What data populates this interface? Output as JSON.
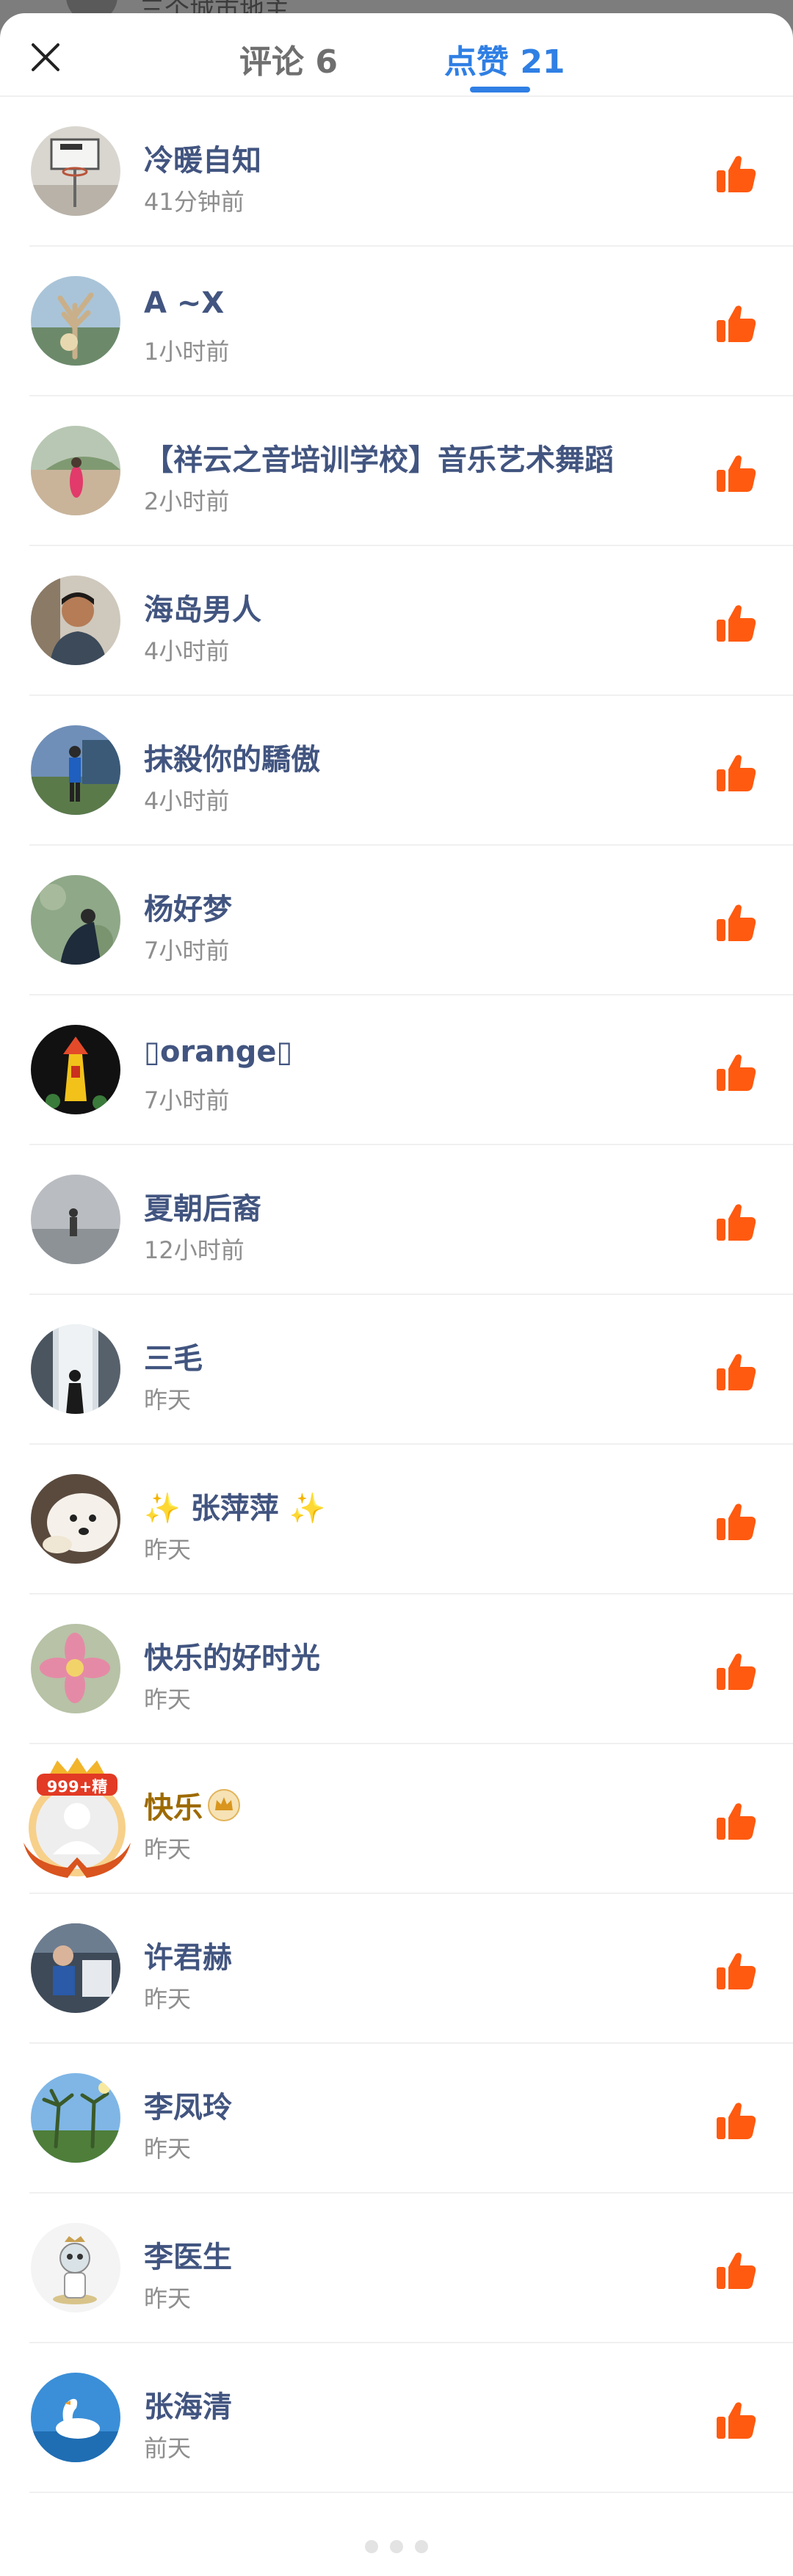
{
  "behind_page": {
    "text": "三个城市地主"
  },
  "header": {
    "tabs": [
      {
        "label": "评论 6"
      },
      {
        "label": "点赞 21"
      }
    ]
  },
  "colors": {
    "accent": "#2f7fe4",
    "like": "#ff5a0f",
    "name": "#425580",
    "vip_name": "#9d6a00"
  },
  "likes": [
    {
      "name": "冷暖自知",
      "time": "41分钟前",
      "avatar": "basketball-hoop"
    },
    {
      "name": "A ~X",
      "time": "1小时前",
      "avatar": "tree-sculpture"
    },
    {
      "name": "【祥云之音培训学校】音乐艺术舞蹈",
      "time": "2小时前",
      "avatar": "girl-on-path"
    },
    {
      "name": "海岛男人",
      "time": "4小时前",
      "avatar": "man-portrait"
    },
    {
      "name": "抹殺你的驕傲",
      "time": "4小时前",
      "avatar": "person-outdoors"
    },
    {
      "name": "杨好梦",
      "time": "7小时前",
      "avatar": "person-in-field"
    },
    {
      "name": "▯orange▯",
      "time": "7小时前",
      "avatar": "yellow-tower"
    },
    {
      "name": "夏朝后裔",
      "time": "12小时前",
      "avatar": "person-at-sea"
    },
    {
      "name": "三毛",
      "time": "昨天",
      "avatar": "waterfall-silhouette"
    },
    {
      "name": "张萍萍",
      "prefix": "✨",
      "suffix": "✨",
      "time": "昨天",
      "avatar": "white-dog"
    },
    {
      "name": "快乐的好时光",
      "time": "昨天",
      "avatar": "pink-flower"
    },
    {
      "name": "快乐",
      "time": "昨天",
      "avatar": "default-vip",
      "badge": "999+精"
    },
    {
      "name": "许君赫",
      "time": "昨天",
      "avatar": "child-photo"
    },
    {
      "name": "李凤玲",
      "time": "昨天",
      "avatar": "palm-trees"
    },
    {
      "name": "李医生",
      "time": "昨天",
      "avatar": "cartoon-doctor"
    },
    {
      "name": "张海清",
      "time": "前天",
      "avatar": "white-swan"
    }
  ]
}
